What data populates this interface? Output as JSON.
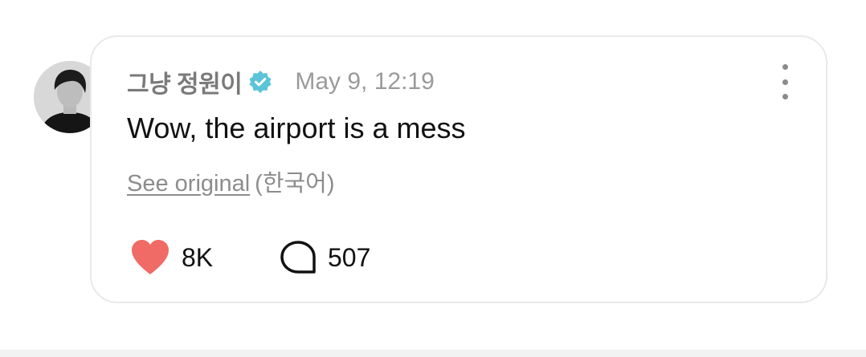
{
  "post": {
    "author_name": "그냥 정원이",
    "verified_icon": "verified-badge-icon",
    "timestamp": "May 9, 12:19",
    "text": "Wow, the airport is a mess",
    "see_original_label": "See original",
    "original_language": "(한국어)",
    "likes": "8K",
    "comments": "507",
    "more_icon": "more-vertical-icon"
  },
  "colors": {
    "verified": "#5bc4d8",
    "heart": "#f06a66"
  }
}
